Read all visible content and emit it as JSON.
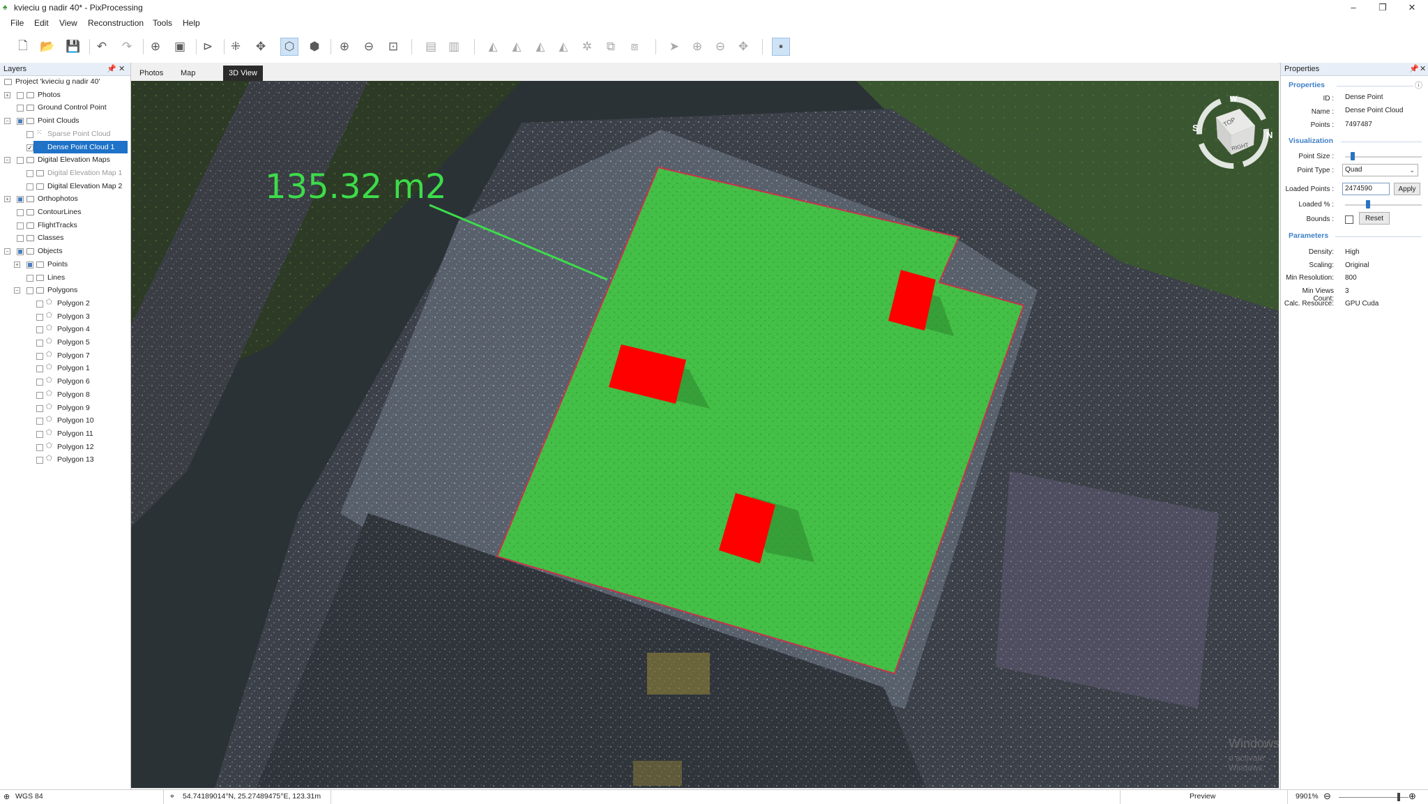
{
  "window": {
    "title": "kvieciu g nadir 40* - PixProcessing",
    "min": "–",
    "restore": "❐",
    "close": "✕"
  },
  "menu": [
    "File",
    "Edit",
    "View",
    "Reconstruction",
    "Tools",
    "Help"
  ],
  "layers": {
    "title": "Layers",
    "rows": [
      "Project 'kvieciu g nadir 40'",
      "Photos",
      "Ground Control Point",
      "Point Clouds",
      "Sparse Point Cloud",
      "Dense Point Cloud 1",
      "Digital Elevation Maps",
      "Digital Elevation Map 1",
      "Digital Elevation Map 2",
      "Orthophotos",
      "ContourLines",
      "FlightTracks",
      "Classes",
      "Objects",
      "Points",
      "Lines",
      "Polygons",
      "Polygon 2",
      "Polygon 3",
      "Polygon 4",
      "Polygon 5",
      "Polygon 7",
      "Polygon 1",
      "Polygon 6",
      "Polygon 8",
      "Polygon 9",
      "Polygon 10",
      "Polygon 11",
      "Polygon 12",
      "Polygon 13"
    ]
  },
  "tabs": [
    "Photos",
    "Map",
    "3D View"
  ],
  "viewport": {
    "measurement": "135.32 m2",
    "watermark": "Windows",
    "watermark_sub": "o activate Windows.",
    "cube_top": "TOP",
    "cube_right": "RIGHT",
    "compass_s": "S",
    "compass_n": "N",
    "compass_w": "W"
  },
  "properties": {
    "title": "Properties",
    "section_properties": "Properties",
    "id_label": "ID :",
    "id_value": "Dense Point",
    "name_label": "Name :",
    "name_value": "Dense Point Cloud",
    "points_label": "Points :",
    "points_value": "7497487",
    "section_visualization": "Visualization",
    "point_size_label": "Point Size :",
    "point_type_label": "Point Type :",
    "point_type_value": "Quad",
    "loaded_points_label": "Loaded Points :",
    "loaded_points_value": "2474590",
    "apply": "Apply",
    "loaded_pct_label": "Loaded % :",
    "bounds_label": "Bounds :",
    "reset": "Reset",
    "section_parameters": "Parameters",
    "density_label": "Density:",
    "density_value": "High",
    "scaling_label": "Scaling:",
    "scaling_value": "Original",
    "minres_label": "Min Resolution:",
    "minres_value": "800",
    "minviews_label": "Min Views Count:",
    "minviews_value": "3",
    "calc_label": "Calc. Resource:",
    "calc_value": "GPU Cuda"
  },
  "status": {
    "crs": "WGS 84",
    "coords": "54.74189014°N, 25.27489475°E, 123.31m",
    "mode": "Preview",
    "zoom": "9901%"
  },
  "colors": {
    "accent": "#1e72c8",
    "polygon_fill": "#3fd03f",
    "obstacle": "#ff0000",
    "measurement": "#3ddc4a"
  }
}
